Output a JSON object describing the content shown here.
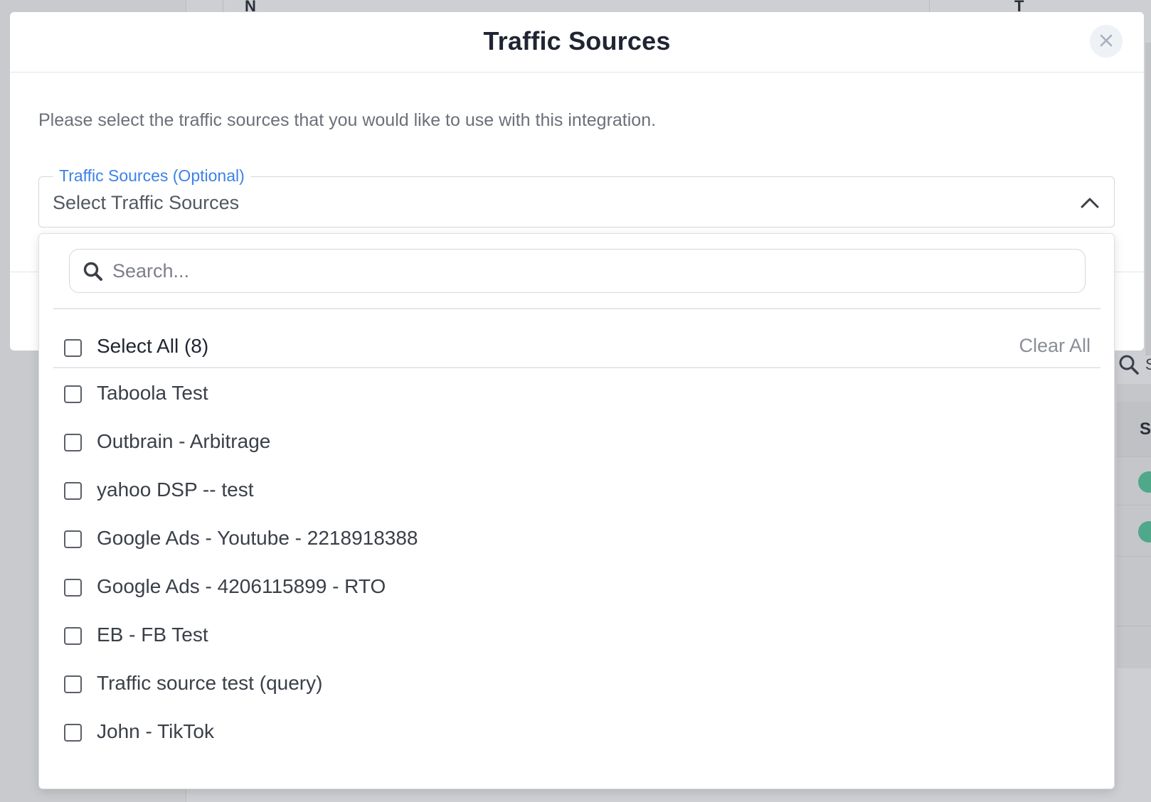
{
  "background": {
    "header_letters": [
      "N",
      "T"
    ],
    "right_header_letter": "S",
    "search_partial": "S"
  },
  "modal": {
    "title": "Traffic Sources",
    "description": "Please select the traffic sources that you would like to use with this integration.",
    "field": {
      "legend": "Traffic Sources (Optional)",
      "value": "Select Traffic Sources"
    }
  },
  "dropdown": {
    "search_placeholder": "Search...",
    "select_all_label": "Select All (8)",
    "clear_all_label": "Clear All",
    "options": [
      "Taboola Test",
      "Outbrain - Arbitrage",
      "yahoo DSP -- test",
      "Google Ads - Youtube - 2218918388",
      "Google Ads - 4206115899 - RTO",
      "EB - FB Test",
      "Traffic source test (query)",
      "John - TikTok"
    ]
  },
  "colors": {
    "accent": "#3b82e8",
    "primary_button": "#3d7ef0",
    "status_green": "#4fa88a"
  }
}
